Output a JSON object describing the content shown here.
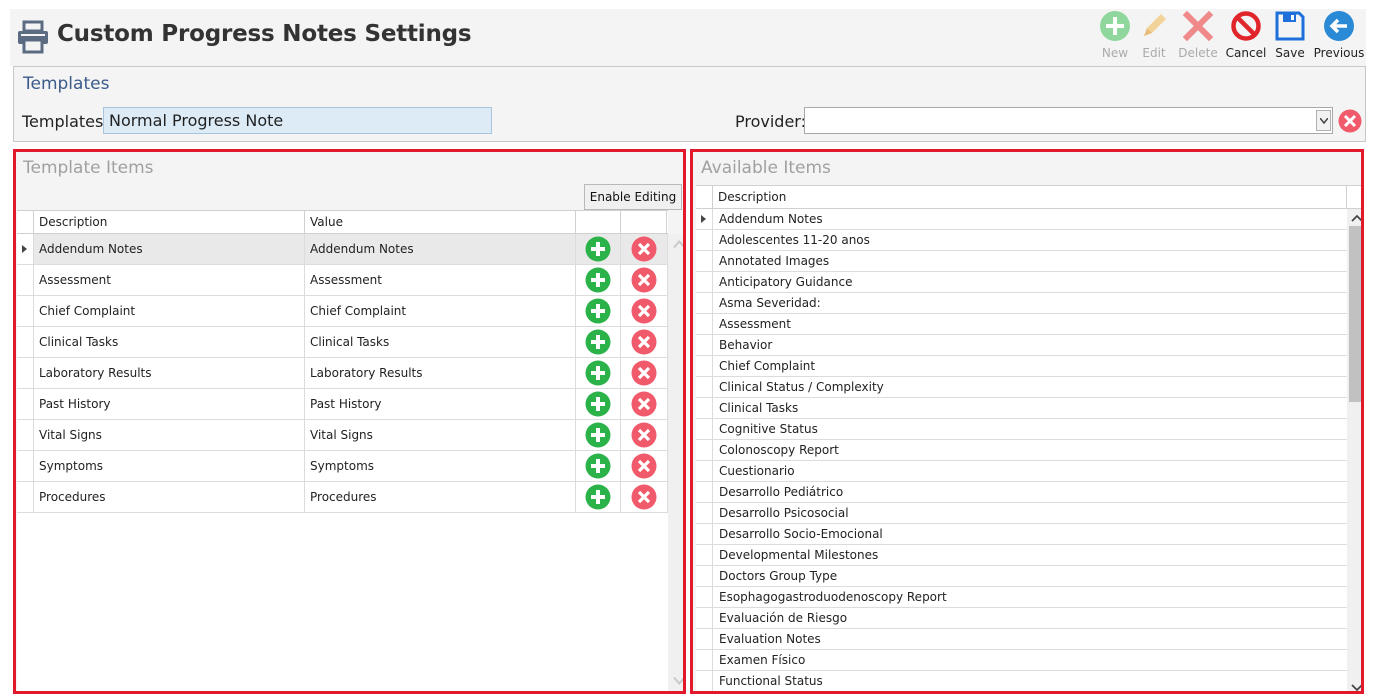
{
  "header": {
    "title": "Custom Progress Notes Settings",
    "icon": "printer-icon",
    "toolbar": [
      {
        "id": "new",
        "label": "New",
        "icon": "add-circle-icon",
        "enabled": false,
        "color": "#8fd79c"
      },
      {
        "id": "edit",
        "label": "Edit",
        "icon": "pencil-icon",
        "enabled": false,
        "color": "#f2d49a"
      },
      {
        "id": "delete",
        "label": "Delete",
        "icon": "x-mark-icon",
        "enabled": false,
        "color": "#f08a8a"
      },
      {
        "id": "cancel",
        "label": "Cancel",
        "icon": "no-entry-icon",
        "enabled": true,
        "color": "#e0262b"
      },
      {
        "id": "save",
        "label": "Save",
        "icon": "floppy-disk-icon",
        "enabled": true,
        "color": "#1e6fd9"
      },
      {
        "id": "previous",
        "label": "Previous",
        "icon": "arrow-left-circle-icon",
        "enabled": true,
        "color": "#2a8ad6"
      }
    ]
  },
  "templates_section": {
    "title": "Templates",
    "templates_label": "Templates:",
    "templates_value": "Normal Progress Note",
    "provider_label": "Provider:",
    "provider_value": ""
  },
  "template_items": {
    "title": "Template Items",
    "enable_editing_label": "Enable Editing",
    "columns": [
      "Description",
      "Value"
    ],
    "rows": [
      {
        "description": "Addendum Notes",
        "value": "Addendum Notes"
      },
      {
        "description": "Assessment",
        "value": "Assessment"
      },
      {
        "description": "Chief Complaint",
        "value": "Chief Complaint"
      },
      {
        "description": "Clinical Tasks",
        "value": "Clinical Tasks"
      },
      {
        "description": "Laboratory Results",
        "value": "Laboratory Results"
      },
      {
        "description": "Past History",
        "value": "Past History"
      },
      {
        "description": "Vital Signs",
        "value": "Vital Signs"
      },
      {
        "description": "Symptoms",
        "value": "Symptoms"
      },
      {
        "description": "Procedures",
        "value": "Procedures"
      }
    ],
    "selected_row": 0,
    "add_color": "#2bb34a",
    "remove_color": "#f05a6a"
  },
  "available_items": {
    "title": "Available Items",
    "columns": [
      "Description"
    ],
    "rows": [
      "Addendum Notes",
      "Adolescentes 11-20 anos",
      "Annotated Images",
      "Anticipatory Guidance",
      "Asma Severidad:",
      "Assessment",
      "Behavior",
      "Chief Complaint",
      "Clinical Status / Complexity",
      "Clinical Tasks",
      "Cognitive Status",
      "Colonoscopy Report",
      "Cuestionario",
      "Desarrollo Pediátrico",
      "Desarrollo Psicosocial",
      "Desarrollo Socio-Emocional",
      "Developmental Milestones",
      "Doctors Group Type",
      "Esophagogastroduodenoscopy Report",
      "Evaluación de Riesgo",
      "Evaluation Notes",
      "Examen Físico",
      "Functional Status"
    ],
    "selected_row": 0
  },
  "colors": {
    "panel_border": "#e01a2b",
    "section_title": "#3c5a8a",
    "input_bg": "#dcebf6"
  }
}
